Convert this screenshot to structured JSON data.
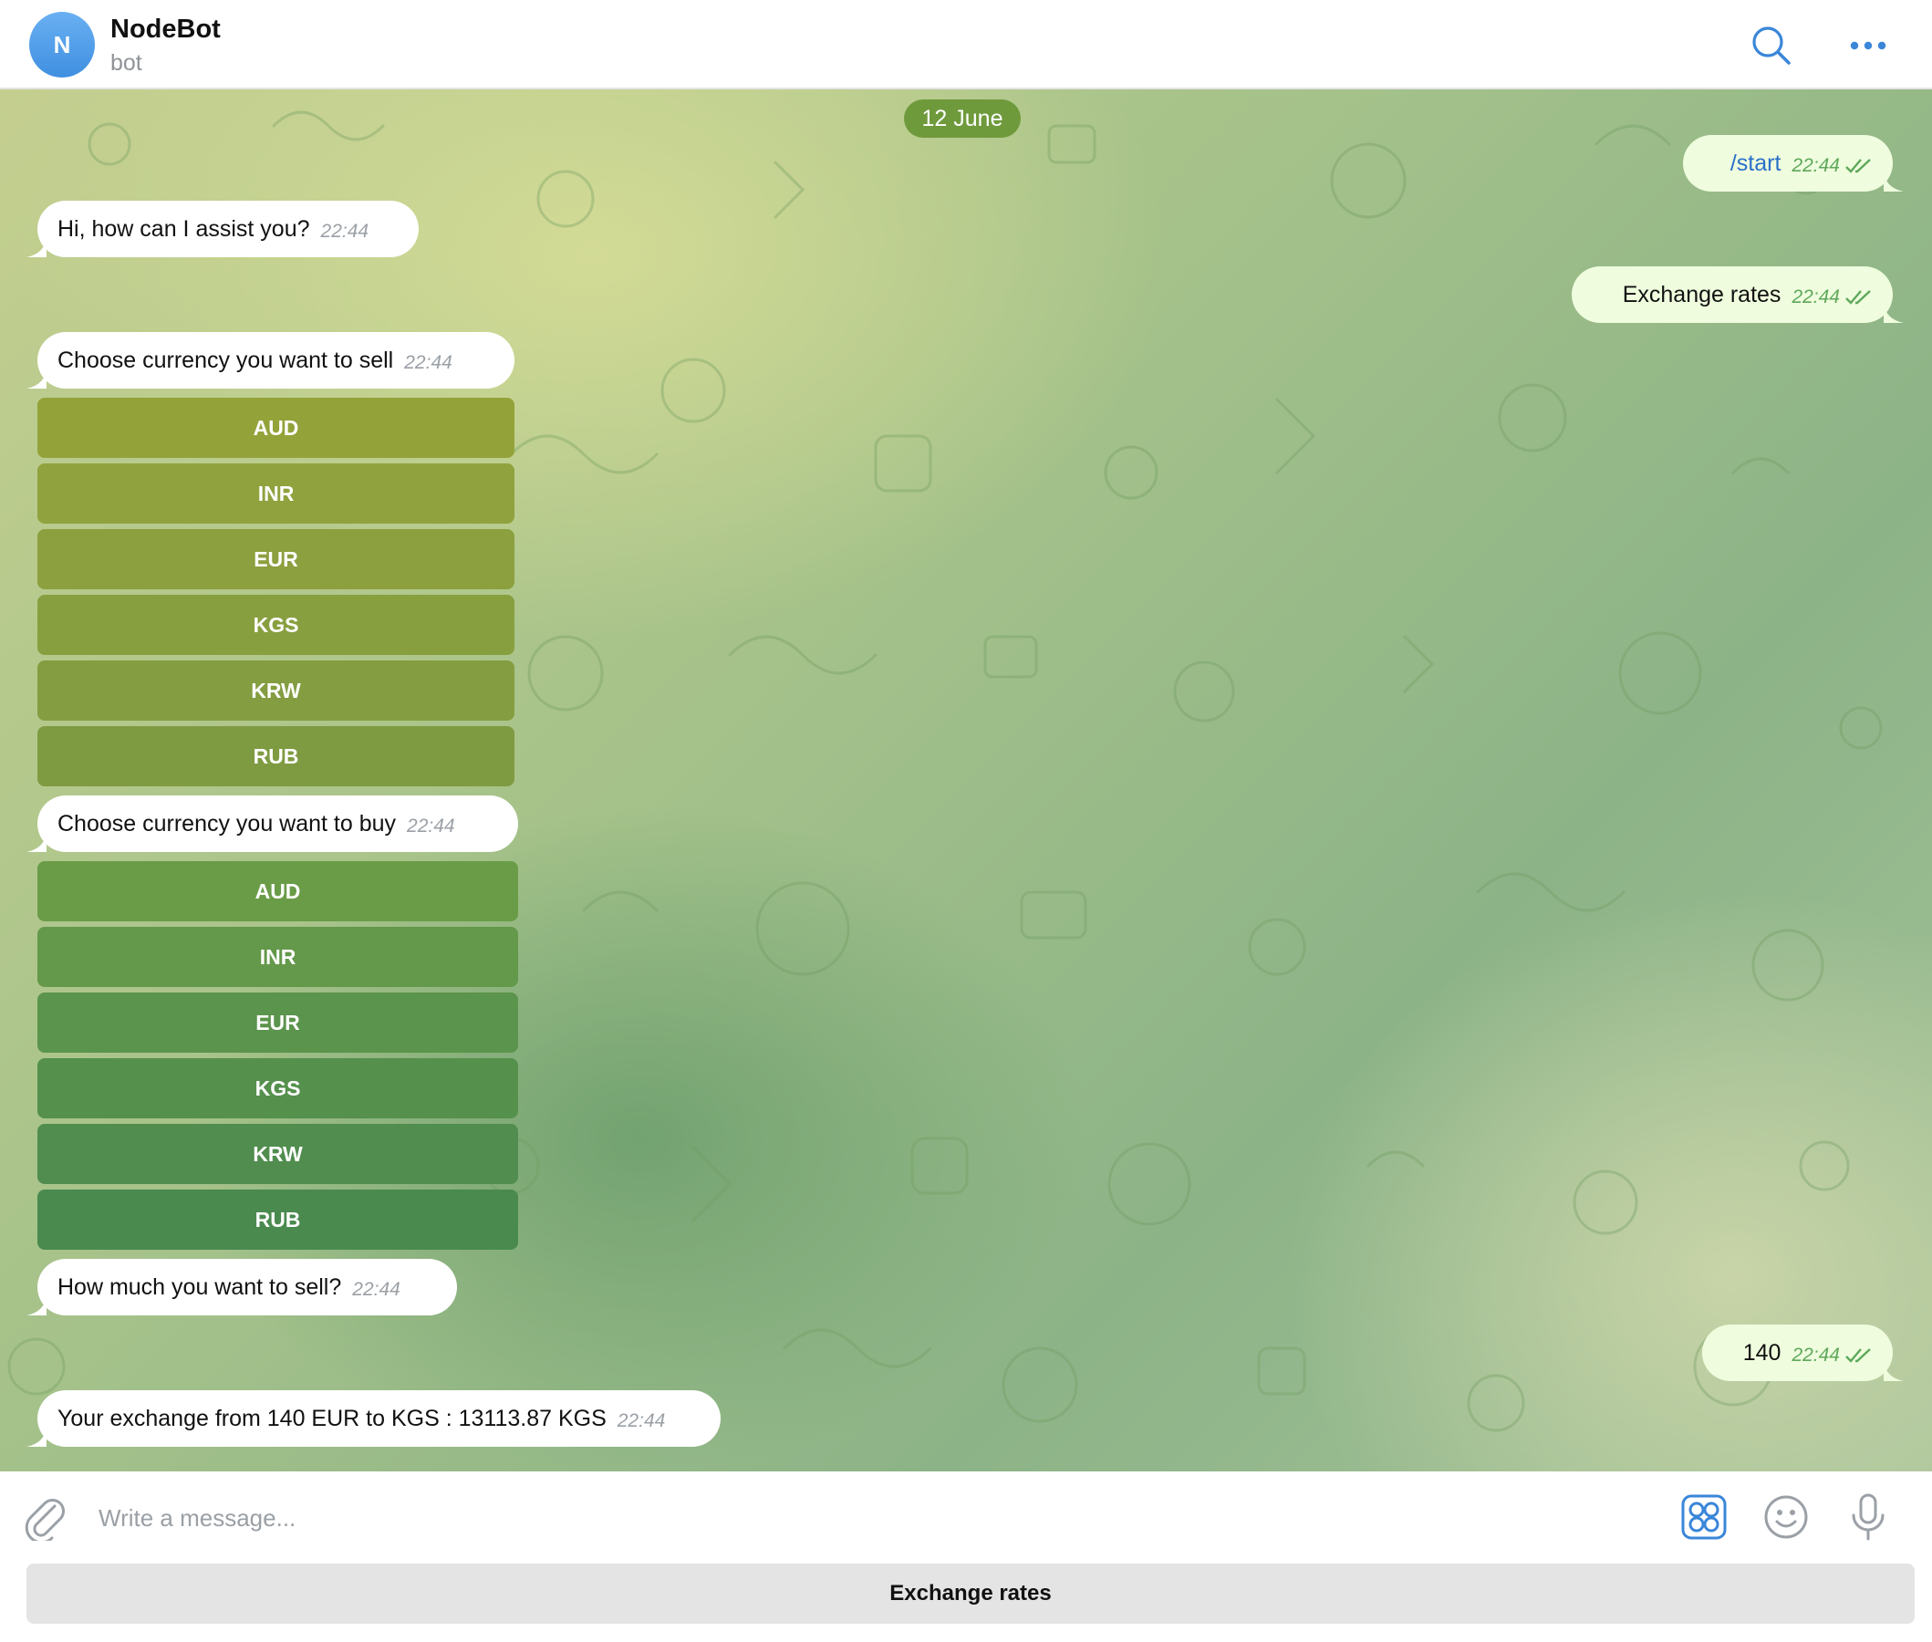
{
  "header": {
    "avatar_letter": "N",
    "title": "NodeBot",
    "subtitle": "bot",
    "icons": [
      "search-icon",
      "more-icon"
    ],
    "avatar_color": "#4f9ee8"
  },
  "chat": {
    "date": "12 June",
    "messages": [
      {
        "side": "out",
        "text": "/start",
        "time": "22:44",
        "status": "read"
      },
      {
        "side": "in",
        "text": "Hi, how can I assist you?",
        "time": "22:44"
      },
      {
        "side": "out",
        "text": "Exchange rates",
        "time": "22:44",
        "status": "read"
      },
      {
        "side": "in",
        "text": "Choose currency you want to sell",
        "time": "22:44",
        "buttons": [
          "AUD",
          "INR",
          "EUR",
          "KGS",
          "KRW",
          "RUB"
        ]
      },
      {
        "side": "in",
        "text": "Choose currency you want to buy",
        "time": "22:44",
        "buttons": [
          "AUD",
          "INR",
          "EUR",
          "KGS",
          "KRW",
          "RUB"
        ]
      },
      {
        "side": "in",
        "text": "How much you want to sell?",
        "time": "22:44"
      },
      {
        "side": "out",
        "text": "140",
        "time": "22:44",
        "status": "read"
      },
      {
        "side": "in",
        "text": "Your exchange from 140 EUR to KGS : 13113.87 KGS",
        "time": "22:44"
      }
    ]
  },
  "composer": {
    "placeholder": "Write a message...",
    "value": "",
    "icons": [
      "attach-icon",
      "bot-commands-icon",
      "emoji-icon",
      "microphone-icon"
    ]
  },
  "reply_keyboard": {
    "buttons": [
      "Exchange rates"
    ]
  },
  "colors": {
    "outgoing_bubble": "#effdde",
    "incoming_bubble": "#ffffff",
    "accent": "#3a86d9",
    "inline_button_top": "#93a33a",
    "inline_button_bottom": "#4a8a4f"
  }
}
